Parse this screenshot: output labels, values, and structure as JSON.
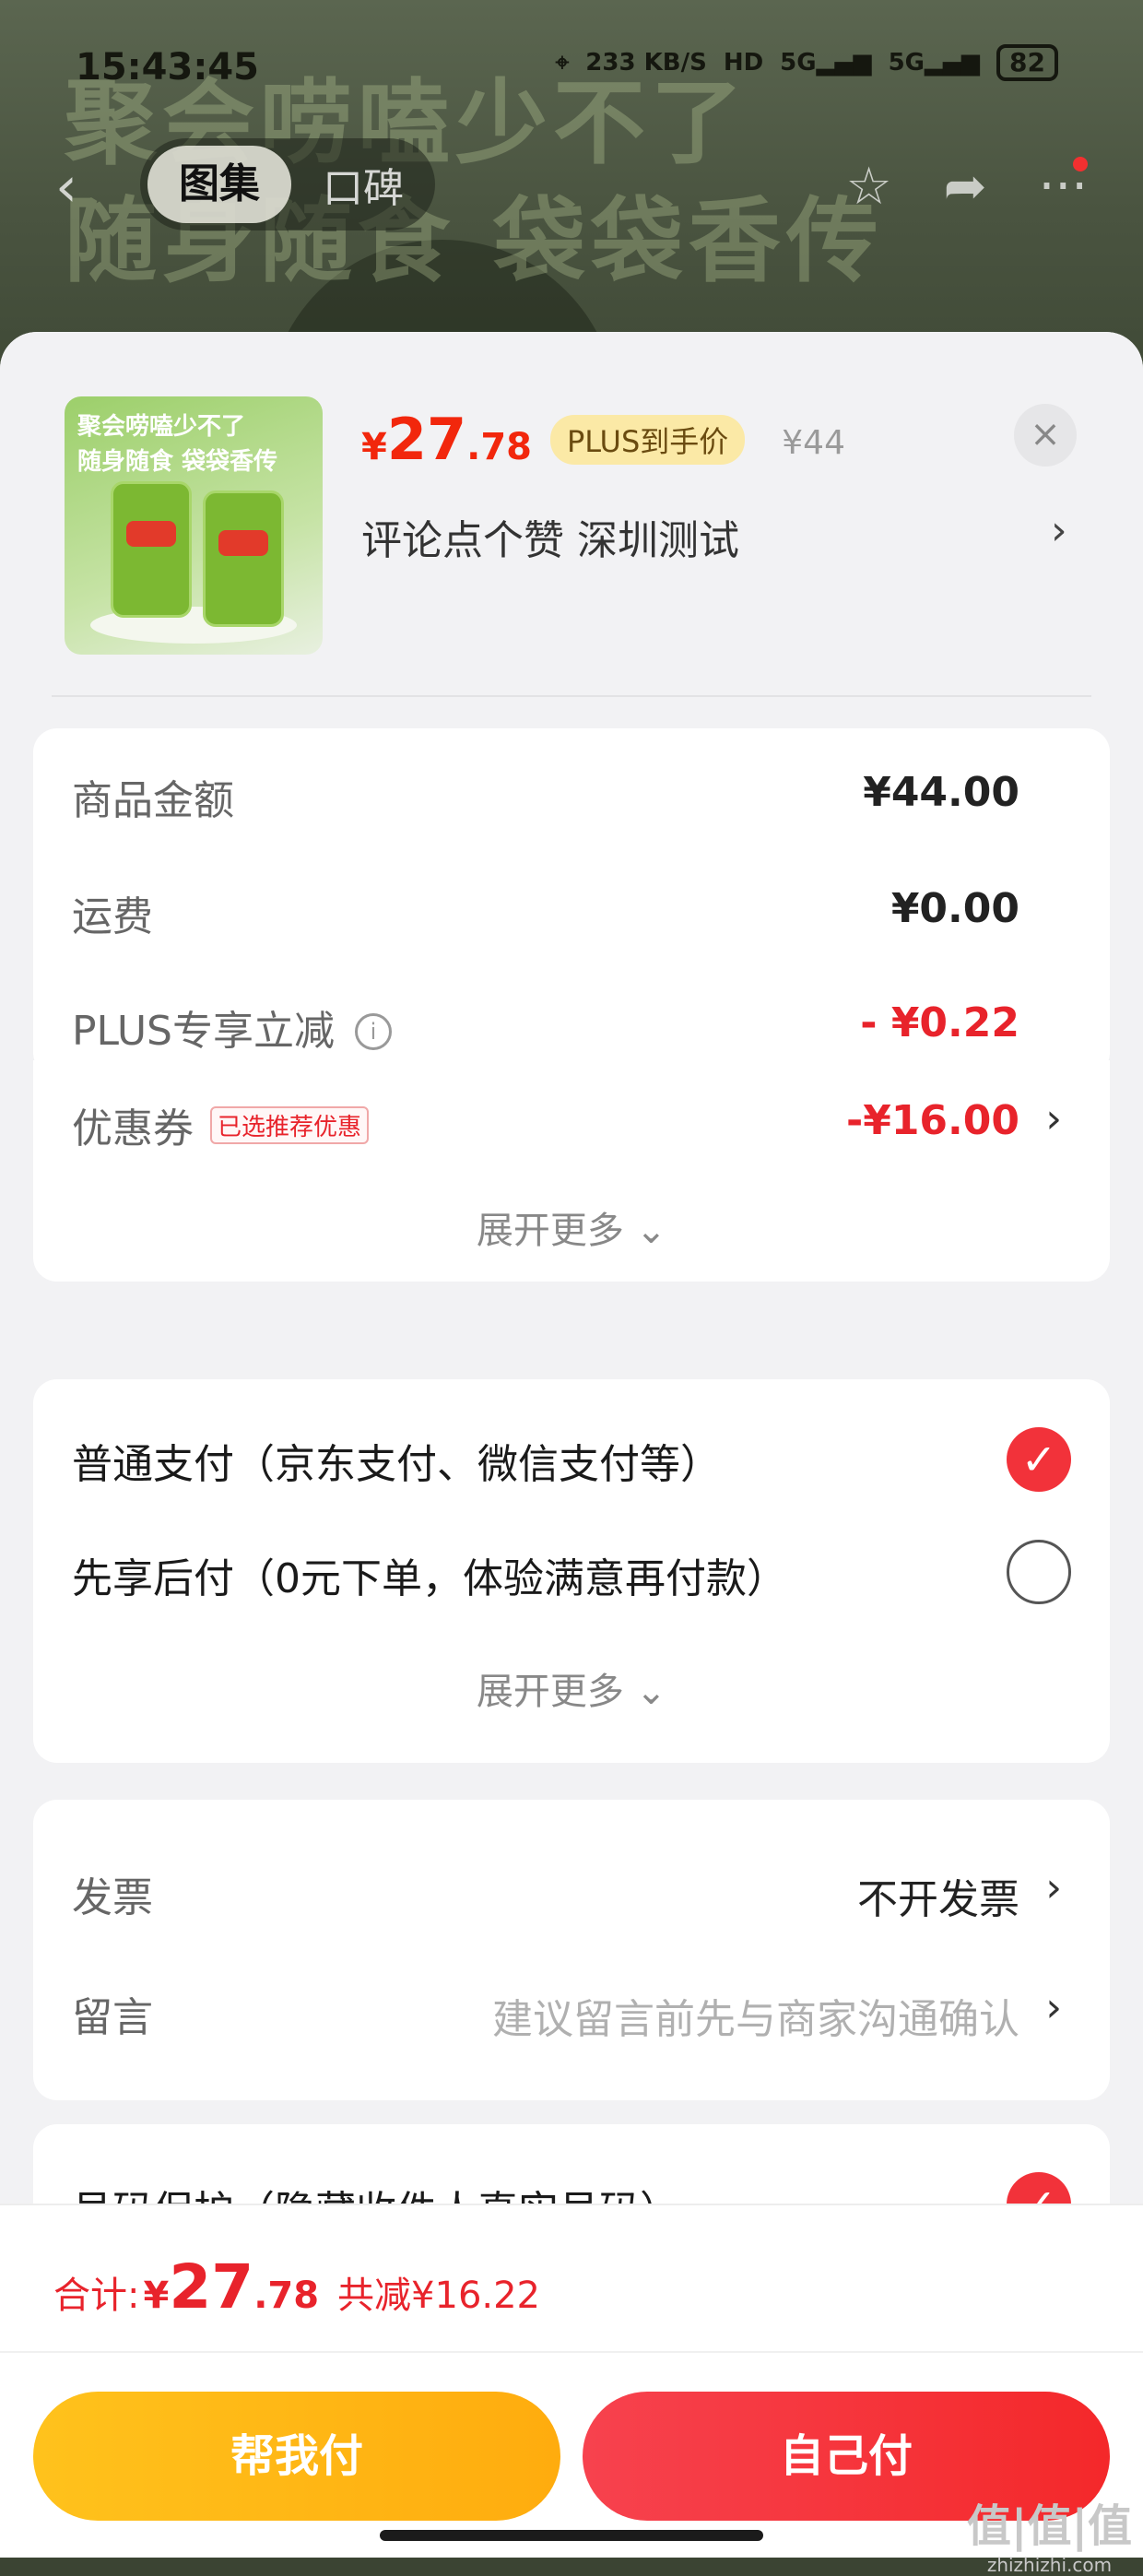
{
  "status_bar": {
    "time": "15:43:45",
    "net_speed": "233 KB/S",
    "hd": "HD",
    "signal1": "5G",
    "signal2": "5G",
    "battery": "82"
  },
  "top_nav": {
    "tabs": [
      {
        "label": "图集",
        "active": true
      },
      {
        "label": "口碑",
        "active": false
      }
    ],
    "icons": [
      "back-icon",
      "star-icon",
      "share-icon",
      "more-icon"
    ],
    "background_banner": [
      "聚会唠嗑少不了",
      "随身随食  袋袋香传"
    ]
  },
  "product": {
    "thumb_text": [
      "聚会唠嗑少不了",
      "随身随食  袋袋香传"
    ],
    "price_yen": "¥",
    "price_main": "27",
    "price_decimal": ".78",
    "plus_badge": "PLUS到手价",
    "original_price": "¥44",
    "spec": "评论点个赞  深圳测试",
    "close": "×"
  },
  "summary": {
    "rows": [
      {
        "label": "商品金额",
        "value": "¥44.00"
      },
      {
        "label": "运费",
        "value": "¥0.00"
      },
      {
        "label": "PLUS专享立减",
        "value": "- ¥0.22"
      },
      {
        "label": "优惠券",
        "tag": "已选推荐优惠",
        "value": "-¥16.00"
      }
    ],
    "expand": "展开更多"
  },
  "payment": {
    "options": [
      {
        "label": "普通支付（京东支付、微信支付等）",
        "checked": true
      },
      {
        "label": "先享后付（0元下单，体验满意再付款）",
        "checked": false
      }
    ],
    "expand": "展开更多"
  },
  "extra": {
    "invoice_label": "发票",
    "invoice_value": "不开发票",
    "message_label": "留言",
    "message_placeholder": "建议留言前先与商家沟通确认",
    "privacy_label": "号码保护（隐藏收件人真实号码）"
  },
  "footer": {
    "total_label": "合计:",
    "total_yen": "¥",
    "total_main": "27",
    "total_decimal": ".78",
    "saved": "共减¥16.22",
    "btn_help": "帮我付",
    "btn_self": "自己付",
    "watermark": "值|值|值",
    "watermark_url": "zhizhizhi.com"
  },
  "colors": {
    "accent_red": "#f2270c",
    "pay_red": "#f4282a",
    "help_yellow": "#ffb414"
  }
}
